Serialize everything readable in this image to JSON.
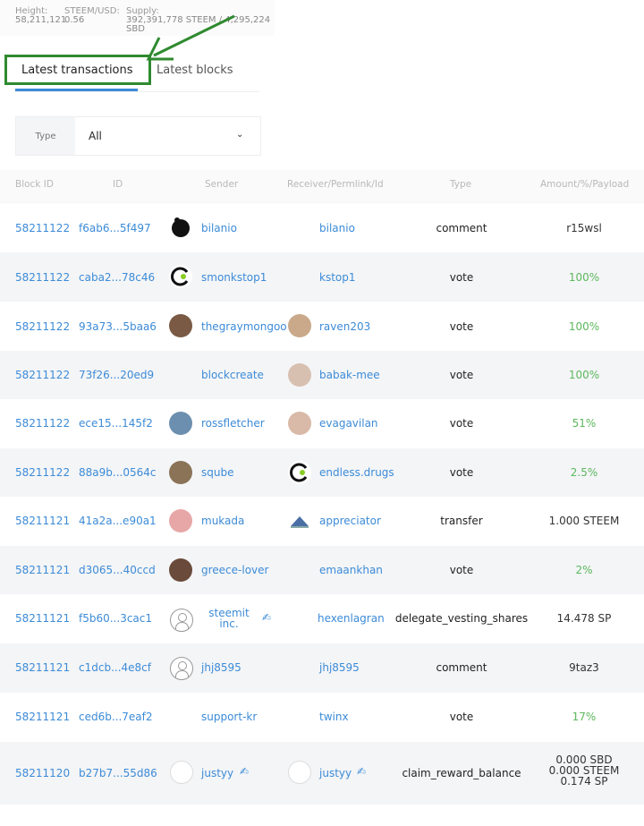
{
  "stats": [
    {
      "label": "Height:",
      "value": "58,211,121"
    },
    {
      "label": "STEEM/USD:",
      "value": "0.56"
    },
    {
      "label": "Supply:",
      "value": "392,391,778 STEEM / 4,295,224 SBD"
    }
  ],
  "tabs": [
    "Latest transactions",
    "Latest blocks"
  ],
  "filter": {
    "label": "Type",
    "value": "All",
    "chevron": "⌄"
  },
  "headers": [
    "Block ID",
    "ID",
    "Sender",
    "Receiver/Permlink/Id",
    "Type",
    "Amount/%/Payload"
  ],
  "rows": [
    {
      "block": "58211122",
      "id": "f6ab6...5f497",
      "sender": "bilanio",
      "receiver": "bilanio",
      "type": "comment",
      "amount": "r15wsl",
      "pct": false
    },
    {
      "block": "58211122",
      "id": "caba2...78c46",
      "sender": "smonkstop1",
      "receiver": "kstop1",
      "type": "vote",
      "amount": "100%",
      "pct": true
    },
    {
      "block": "58211122",
      "id": "93a73...5baa6",
      "sender": "thegraymongoo",
      "receiver": "raven203",
      "type": "vote",
      "amount": "100%",
      "pct": true
    },
    {
      "block": "58211122",
      "id": "73f26...20ed9",
      "sender": "blockcreate",
      "receiver": "babak-mee",
      "type": "vote",
      "amount": "100%",
      "pct": true
    },
    {
      "block": "58211122",
      "id": "ece15...145f2",
      "sender": "rossfletcher",
      "receiver": "evagavilan",
      "type": "vote",
      "amount": "51%",
      "pct": true
    },
    {
      "block": "58211122",
      "id": "88a9b...0564c",
      "sender": "sqube",
      "receiver": "endless.drugs",
      "type": "vote",
      "amount": "2.5%",
      "pct": true
    },
    {
      "block": "58211121",
      "id": "41a2a...e90a1",
      "sender": "mukada",
      "receiver": "appreciator",
      "type": "transfer",
      "amount": "1.000 STEEM",
      "pct": false
    },
    {
      "block": "58211121",
      "id": "d3065...40ccd",
      "sender": "greece-lover",
      "receiver": "emaankhan",
      "type": "vote",
      "amount": "2%",
      "pct": true
    },
    {
      "block": "58211121",
      "id": "f5b60...3cac1",
      "sender": "steemit inc.",
      "receiver": "hexenlagran",
      "type": "delegate_vesting_shares",
      "amount": "14.478 SP",
      "pct": false
    },
    {
      "block": "58211121",
      "id": "c1dcb...4e8cf",
      "sender": "jhj8595",
      "receiver": "jhj8595",
      "type": "comment",
      "amount": "9taz3",
      "pct": false
    },
    {
      "block": "58211121",
      "id": "ced6b...7eaf2",
      "sender": "support-kr",
      "receiver": "twinx",
      "type": "vote",
      "amount": "17%",
      "pct": true
    },
    {
      "block": "58211120",
      "id": "b27b7...55d86",
      "sender": "justyy",
      "receiver": "justyy",
      "type": "claim_reward_balance",
      "amount_lines": [
        "0.000 SBD",
        "0.000 STEEM",
        "0.174 SP"
      ],
      "pct": false
    }
  ],
  "colors": {
    "link": "#3c8bd7",
    "positive": "#5cb85c",
    "highlight": "#2f8a2f"
  }
}
